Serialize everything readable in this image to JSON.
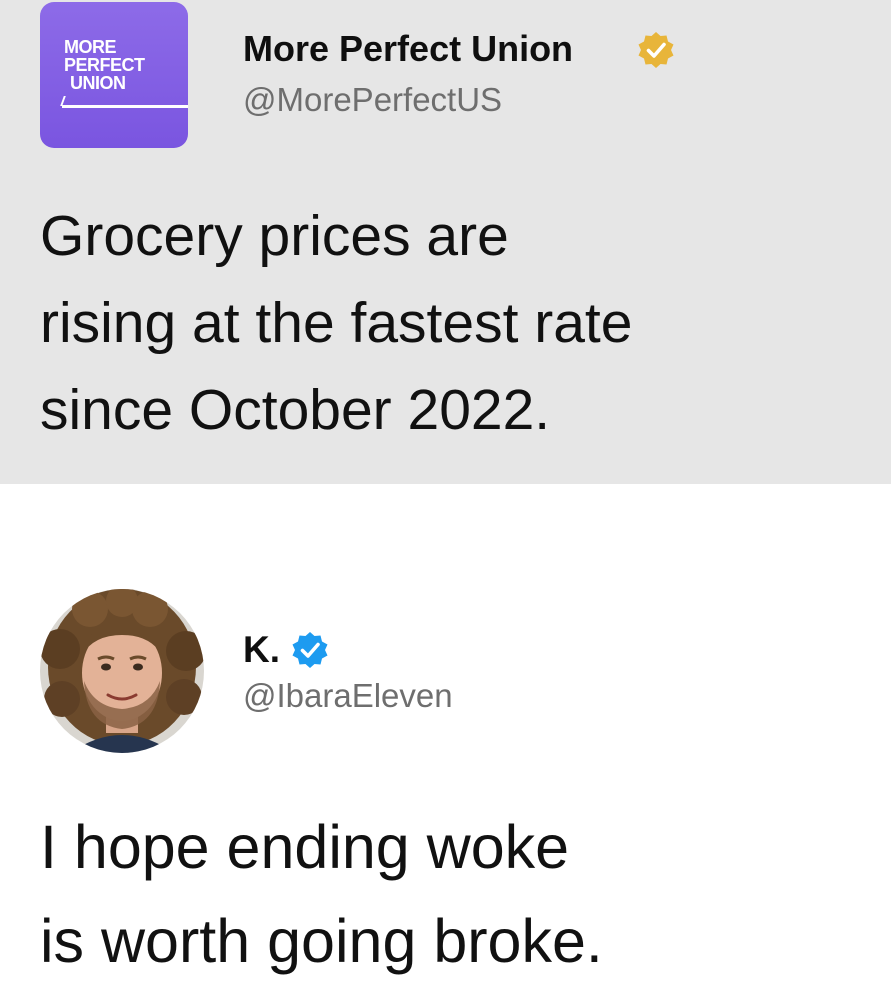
{
  "tweets": [
    {
      "logo_lines": [
        "MORE",
        "PERFECT",
        "UNION"
      ],
      "display_name": "More Perfect Union",
      "verified_badge": "gold-verified-check-icon",
      "handle": "@MorePerfectUS",
      "text_lines": [
        "Grocery prices are",
        "rising at the fastest rate",
        "since October 2022."
      ]
    },
    {
      "avatar": "bearded-man-curly-hair-avatar",
      "display_name": "K.",
      "verified_badge": "blue-verified-check-icon",
      "handle": "@IbaraEleven",
      "text_lines": [
        "I hope ending woke",
        "is worth going broke."
      ]
    }
  ],
  "colors": {
    "card_background": "#e6e6e6",
    "page_background": "#ffffff",
    "logo_purple": "#7a55e0",
    "gold_badge": "#e8b53a",
    "blue_badge": "#1d9bf0",
    "handle_gray": "#6e6e6e"
  }
}
